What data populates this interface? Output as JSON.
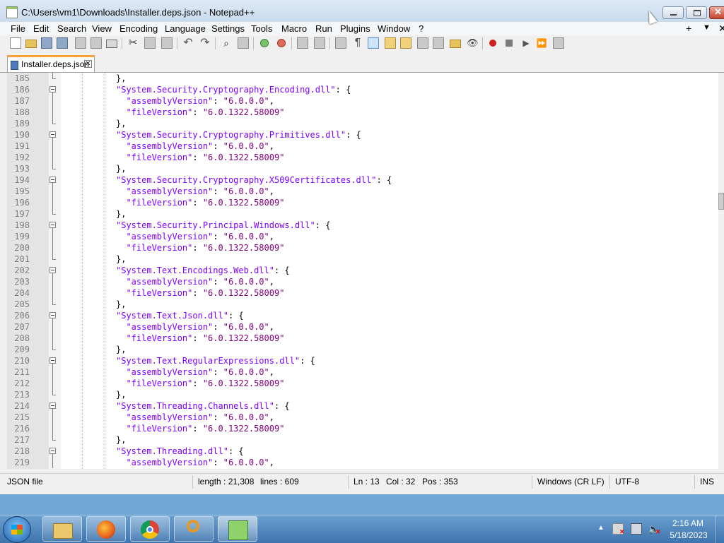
{
  "window": {
    "title": "C:\\Users\\vm1\\Downloads\\Installer.deps.json - Notepad++",
    "app_icon": "notepad-icon"
  },
  "menubar": {
    "items": [
      "File",
      "Edit",
      "Search",
      "View",
      "Encoding",
      "Language",
      "Settings",
      "Tools",
      "Macro",
      "Run",
      "Plugins",
      "Window",
      "?"
    ],
    "right_controls": {
      "plus": "+",
      "down": "▼",
      "close": "✕"
    }
  },
  "tab": {
    "label": "Installer.deps.json",
    "close": "✕"
  },
  "editor": {
    "lines": [
      {
        "n": "185",
        "code": [
          {
            "t": "},",
            "c": "p"
          }
        ],
        "fold": "end"
      },
      {
        "n": "186",
        "code": [
          {
            "t": "\"System.Security.Cryptography.Encoding.dll\"",
            "c": "k"
          },
          {
            "t": ": {",
            "c": "p"
          }
        ],
        "fold": "open"
      },
      {
        "n": "187",
        "code": [
          {
            "t": "  \"assemblyVersion\"",
            "c": "k"
          },
          {
            "t": ": ",
            "c": "p"
          },
          {
            "t": "\"6.0.0.0\"",
            "c": "s"
          },
          {
            "t": ",",
            "c": "p"
          }
        ],
        "fold": "line"
      },
      {
        "n": "188",
        "code": [
          {
            "t": "  \"fileVersion\"",
            "c": "k"
          },
          {
            "t": ": ",
            "c": "p"
          },
          {
            "t": "\"6.0.1322.58009\"",
            "c": "s"
          }
        ],
        "fold": "line"
      },
      {
        "n": "189",
        "code": [
          {
            "t": "},",
            "c": "p"
          }
        ],
        "fold": "end"
      },
      {
        "n": "190",
        "code": [
          {
            "t": "\"System.Security.Cryptography.Primitives.dll\"",
            "c": "k"
          },
          {
            "t": ": {",
            "c": "p"
          }
        ],
        "fold": "open"
      },
      {
        "n": "191",
        "code": [
          {
            "t": "  \"assemblyVersion\"",
            "c": "k"
          },
          {
            "t": ": ",
            "c": "p"
          },
          {
            "t": "\"6.0.0.0\"",
            "c": "s"
          },
          {
            "t": ",",
            "c": "p"
          }
        ],
        "fold": "line"
      },
      {
        "n": "192",
        "code": [
          {
            "t": "  \"fileVersion\"",
            "c": "k"
          },
          {
            "t": ": ",
            "c": "p"
          },
          {
            "t": "\"6.0.1322.58009\"",
            "c": "s"
          }
        ],
        "fold": "line"
      },
      {
        "n": "193",
        "code": [
          {
            "t": "},",
            "c": "p"
          }
        ],
        "fold": "end"
      },
      {
        "n": "194",
        "code": [
          {
            "t": "\"System.Security.Cryptography.X509Certificates.dll\"",
            "c": "k"
          },
          {
            "t": ": {",
            "c": "p"
          }
        ],
        "fold": "open"
      },
      {
        "n": "195",
        "code": [
          {
            "t": "  \"assemblyVersion\"",
            "c": "k"
          },
          {
            "t": ": ",
            "c": "p"
          },
          {
            "t": "\"6.0.0.0\"",
            "c": "s"
          },
          {
            "t": ",",
            "c": "p"
          }
        ],
        "fold": "line"
      },
      {
        "n": "196",
        "code": [
          {
            "t": "  \"fileVersion\"",
            "c": "k"
          },
          {
            "t": ": ",
            "c": "p"
          },
          {
            "t": "\"6.0.1322.58009\"",
            "c": "s"
          }
        ],
        "fold": "line"
      },
      {
        "n": "197",
        "code": [
          {
            "t": "},",
            "c": "p"
          }
        ],
        "fold": "end"
      },
      {
        "n": "198",
        "code": [
          {
            "t": "\"System.Security.Principal.Windows.dll\"",
            "c": "k"
          },
          {
            "t": ": {",
            "c": "p"
          }
        ],
        "fold": "open"
      },
      {
        "n": "199",
        "code": [
          {
            "t": "  \"assemblyVersion\"",
            "c": "k"
          },
          {
            "t": ": ",
            "c": "p"
          },
          {
            "t": "\"6.0.0.0\"",
            "c": "s"
          },
          {
            "t": ",",
            "c": "p"
          }
        ],
        "fold": "line"
      },
      {
        "n": "200",
        "code": [
          {
            "t": "  \"fileVersion\"",
            "c": "k"
          },
          {
            "t": ": ",
            "c": "p"
          },
          {
            "t": "\"6.0.1322.58009\"",
            "c": "s"
          }
        ],
        "fold": "line"
      },
      {
        "n": "201",
        "code": [
          {
            "t": "},",
            "c": "p"
          }
        ],
        "fold": "end"
      },
      {
        "n": "202",
        "code": [
          {
            "t": "\"System.Text.Encodings.Web.dll\"",
            "c": "k"
          },
          {
            "t": ": {",
            "c": "p"
          }
        ],
        "fold": "open"
      },
      {
        "n": "203",
        "code": [
          {
            "t": "  \"assemblyVersion\"",
            "c": "k"
          },
          {
            "t": ": ",
            "c": "p"
          },
          {
            "t": "\"6.0.0.0\"",
            "c": "s"
          },
          {
            "t": ",",
            "c": "p"
          }
        ],
        "fold": "line"
      },
      {
        "n": "204",
        "code": [
          {
            "t": "  \"fileVersion\"",
            "c": "k"
          },
          {
            "t": ": ",
            "c": "p"
          },
          {
            "t": "\"6.0.1322.58009\"",
            "c": "s"
          }
        ],
        "fold": "line"
      },
      {
        "n": "205",
        "code": [
          {
            "t": "},",
            "c": "p"
          }
        ],
        "fold": "end"
      },
      {
        "n": "206",
        "code": [
          {
            "t": "\"System.Text.Json.dll\"",
            "c": "k"
          },
          {
            "t": ": {",
            "c": "p"
          }
        ],
        "fold": "open"
      },
      {
        "n": "207",
        "code": [
          {
            "t": "  \"assemblyVersion\"",
            "c": "k"
          },
          {
            "t": ": ",
            "c": "p"
          },
          {
            "t": "\"6.0.0.0\"",
            "c": "s"
          },
          {
            "t": ",",
            "c": "p"
          }
        ],
        "fold": "line"
      },
      {
        "n": "208",
        "code": [
          {
            "t": "  \"fileVersion\"",
            "c": "k"
          },
          {
            "t": ": ",
            "c": "p"
          },
          {
            "t": "\"6.0.1322.58009\"",
            "c": "s"
          }
        ],
        "fold": "line"
      },
      {
        "n": "209",
        "code": [
          {
            "t": "},",
            "c": "p"
          }
        ],
        "fold": "end"
      },
      {
        "n": "210",
        "code": [
          {
            "t": "\"System.Text.RegularExpressions.dll\"",
            "c": "k"
          },
          {
            "t": ": {",
            "c": "p"
          }
        ],
        "fold": "open"
      },
      {
        "n": "211",
        "code": [
          {
            "t": "  \"assemblyVersion\"",
            "c": "k"
          },
          {
            "t": ": ",
            "c": "p"
          },
          {
            "t": "\"6.0.0.0\"",
            "c": "s"
          },
          {
            "t": ",",
            "c": "p"
          }
        ],
        "fold": "line"
      },
      {
        "n": "212",
        "code": [
          {
            "t": "  \"fileVersion\"",
            "c": "k"
          },
          {
            "t": ": ",
            "c": "p"
          },
          {
            "t": "\"6.0.1322.58009\"",
            "c": "s"
          }
        ],
        "fold": "line"
      },
      {
        "n": "213",
        "code": [
          {
            "t": "},",
            "c": "p"
          }
        ],
        "fold": "end"
      },
      {
        "n": "214",
        "code": [
          {
            "t": "\"System.Threading.Channels.dll\"",
            "c": "k"
          },
          {
            "t": ": {",
            "c": "p"
          }
        ],
        "fold": "open"
      },
      {
        "n": "215",
        "code": [
          {
            "t": "  \"assemblyVersion\"",
            "c": "k"
          },
          {
            "t": ": ",
            "c": "p"
          },
          {
            "t": "\"6.0.0.0\"",
            "c": "s"
          },
          {
            "t": ",",
            "c": "p"
          }
        ],
        "fold": "line"
      },
      {
        "n": "216",
        "code": [
          {
            "t": "  \"fileVersion\"",
            "c": "k"
          },
          {
            "t": ": ",
            "c": "p"
          },
          {
            "t": "\"6.0.1322.58009\"",
            "c": "s"
          }
        ],
        "fold": "line"
      },
      {
        "n": "217",
        "code": [
          {
            "t": "},",
            "c": "p"
          }
        ],
        "fold": "end"
      },
      {
        "n": "218",
        "code": [
          {
            "t": "\"System.Threading.dll\"",
            "c": "k"
          },
          {
            "t": ": {",
            "c": "p"
          }
        ],
        "fold": "open"
      },
      {
        "n": "219",
        "code": [
          {
            "t": "  \"assemblyVersion\"",
            "c": "k"
          },
          {
            "t": ": ",
            "c": "p"
          },
          {
            "t": "\"6.0.0.0\"",
            "c": "s"
          },
          {
            "t": ",",
            "c": "p"
          }
        ],
        "fold": "line"
      }
    ]
  },
  "statusbar": {
    "file_type": "JSON file",
    "length": "length : 21,308",
    "lines": "lines : 609",
    "ln": "Ln : 13",
    "col": "Col : 32",
    "pos": "Pos : 353",
    "eol": "Windows (CR LF)",
    "encoding": "UTF-8",
    "mode": "INS"
  },
  "taskbar": {
    "apps": [
      "explorer-icon",
      "firefox-icon",
      "chrome-icon",
      "search-icon",
      "notepadpp-icon"
    ],
    "clock_time": "2:16 AM",
    "clock_date": "5/18/2023"
  },
  "colors": {
    "key": "#8000ff",
    "string": "#800080",
    "tab_accent": "#f9a13a"
  }
}
